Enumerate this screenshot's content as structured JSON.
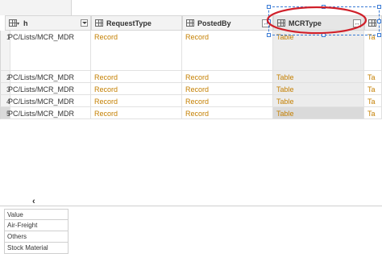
{
  "columns": {
    "first": {
      "label": "h"
    },
    "request_type": {
      "label": "RequestType"
    },
    "posted_by": {
      "label": "PostedBy"
    },
    "mcr_type": {
      "label": "MCRType"
    }
  },
  "rows": [
    {
      "num": "1",
      "url": "PC/Lists/MCR_MDR",
      "request": "Record",
      "posted": "Record",
      "mcr": "Table",
      "extra": "Ta"
    },
    {
      "num": "2",
      "url": "PC/Lists/MCR_MDR",
      "request": "Record",
      "posted": "Record",
      "mcr": "Table",
      "extra": "Ta"
    },
    {
      "num": "3",
      "url": "PC/Lists/MCR_MDR",
      "request": "Record",
      "posted": "Record",
      "mcr": "Table",
      "extra": "Ta"
    },
    {
      "num": "4",
      "url": "PC/Lists/MCR_MDR",
      "request": "Record",
      "posted": "Record",
      "mcr": "Table",
      "extra": "Ta"
    },
    {
      "num": "5",
      "url": "PC/Lists/MCR_MDR",
      "request": "Record",
      "posted": "Record",
      "mcr": "Table",
      "extra": "Ta"
    }
  ],
  "value_table": {
    "header": "Value",
    "items": [
      "Air-Freight",
      "Others",
      "Stock Material"
    ]
  },
  "icons": {
    "scroll_left": "‹"
  },
  "colors": {
    "accent_record": "#c47f00",
    "selection": "#3a7bd5",
    "annotation": "#d0202a"
  }
}
